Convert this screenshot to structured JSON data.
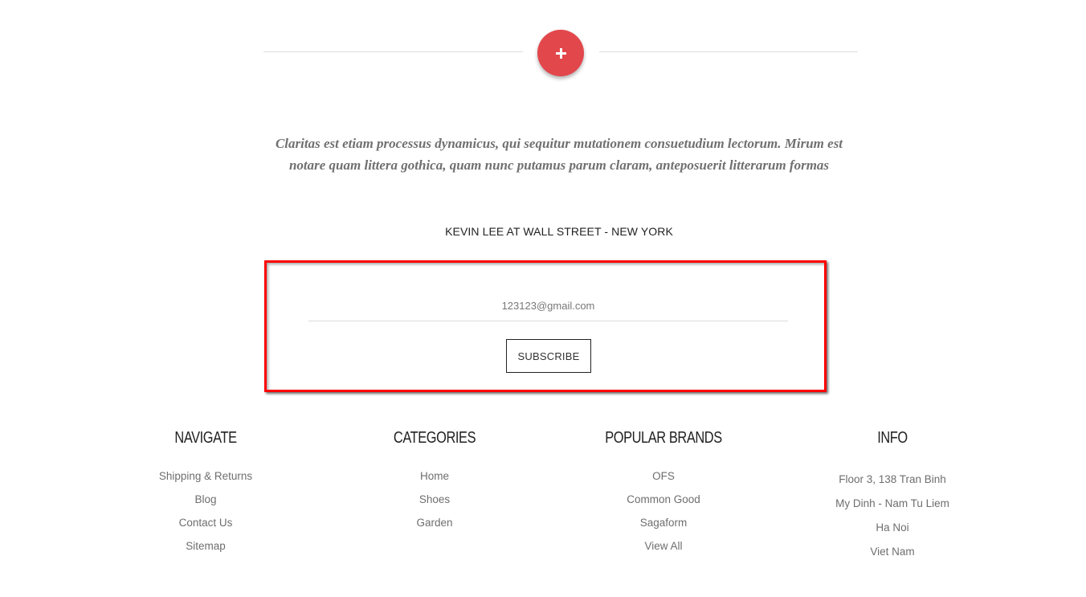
{
  "divider": {
    "button_icon": "plus-icon",
    "accent_color": "#e2474c"
  },
  "testimonial": {
    "quote": "Claritas est etiam processus dynamicus, qui sequitur mutationem consuetudium lectorum. Mirum est notare quam littera gothica, quam nunc putamus parum claram, anteposuerit litterarum formas",
    "author": "KEVIN LEE AT WALL STREET - NEW YORK"
  },
  "newsletter": {
    "email_value": "123123@gmail.com",
    "subscribe_label": "SUBSCRIBE",
    "highlight_color": "#ff0000"
  },
  "footer": {
    "columns": [
      {
        "title": "NAVIGATE",
        "items": [
          "Shipping & Returns",
          "Blog",
          "Contact Us",
          "Sitemap"
        ]
      },
      {
        "title": "CATEGORIES",
        "items": [
          "Home",
          "Shoes",
          "Garden"
        ]
      },
      {
        "title": "POPULAR BRANDS",
        "items": [
          "OFS",
          "Common Good",
          "Sagaform",
          "View All"
        ]
      },
      {
        "title": "INFO",
        "items": [
          "Floor 3, 138 Tran Binh",
          "My Dinh - Nam Tu Liem",
          "Ha Noi",
          "Viet Nam"
        ]
      }
    ]
  }
}
